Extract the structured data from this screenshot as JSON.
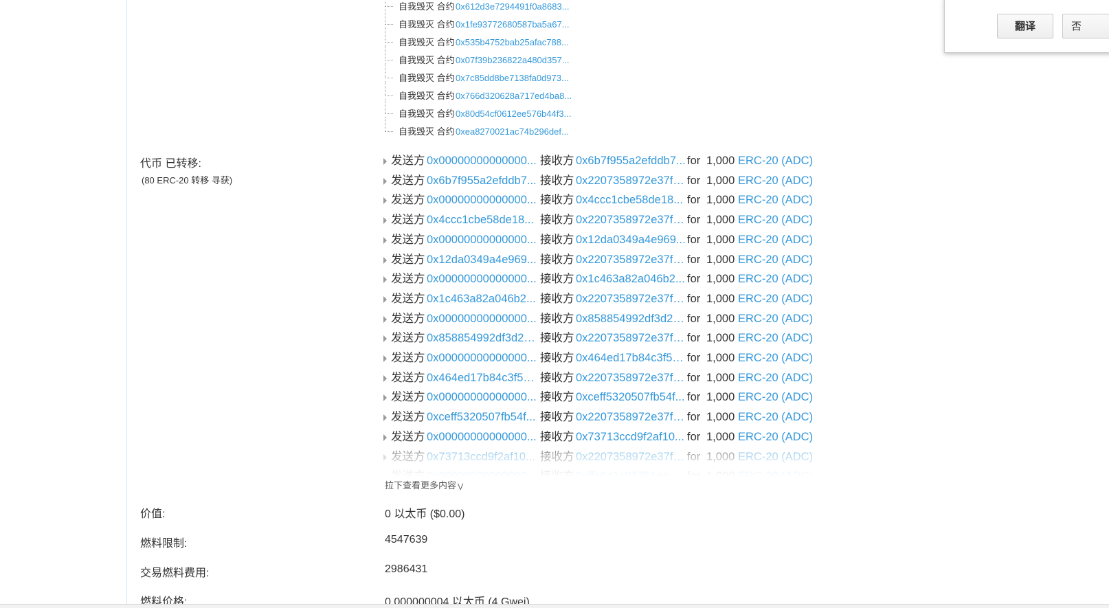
{
  "self_destruct": [
    {
      "label": "自我毁灭 合约",
      "address": "0x612d3e7294491f0a8683..."
    },
    {
      "label": "自我毁灭 合约",
      "address": "0x1fe93772680587ba5a67..."
    },
    {
      "label": "自我毁灭 合约",
      "address": "0x535b4752bab25afac788..."
    },
    {
      "label": "自我毁灭 合约",
      "address": "0x07f39b236822a480d357..."
    },
    {
      "label": "自我毁灭 合约",
      "address": "0x7c85dd8be7138fa0d973..."
    },
    {
      "label": "自我毁灭 合约",
      "address": "0x766d320628a717ed4ba8..."
    },
    {
      "label": "自我毁灭 合约",
      "address": "0x80d54cf0612ee576b44f3..."
    },
    {
      "label": "自我毁灭 合约",
      "address": "0xea8270021ac74b296def..."
    }
  ],
  "token_transfers": {
    "label": "代币 已转移:",
    "sub_label": "(80 ERC-20 转移 寻获)",
    "from_label": "发送方",
    "to_label": "接收方",
    "for_label": "for",
    "rows": [
      {
        "from": "0x00000000000000...",
        "to": "0x6b7f955a2efddb7...",
        "amount": "1,000",
        "token": "ERC-20 (ADC)"
      },
      {
        "from": "0x6b7f955a2efddb7...",
        "to": "0x2207358972e37f6...",
        "amount": "1,000",
        "token": "ERC-20 (ADC)"
      },
      {
        "from": "0x00000000000000...",
        "to": "0x4ccc1cbe58de18...",
        "amount": "1,000",
        "token": "ERC-20 (ADC)"
      },
      {
        "from": "0x4ccc1cbe58de18...",
        "to": "0x2207358972e37f6...",
        "amount": "1,000",
        "token": "ERC-20 (ADC)"
      },
      {
        "from": "0x00000000000000...",
        "to": "0x12da0349a4e969...",
        "amount": "1,000",
        "token": "ERC-20 (ADC)"
      },
      {
        "from": "0x12da0349a4e969...",
        "to": "0x2207358972e37f6...",
        "amount": "1,000",
        "token": "ERC-20 (ADC)"
      },
      {
        "from": "0x00000000000000...",
        "to": "0x1c463a82a046b2...",
        "amount": "1,000",
        "token": "ERC-20 (ADC)"
      },
      {
        "from": "0x1c463a82a046b2...",
        "to": "0x2207358972e37f6...",
        "amount": "1,000",
        "token": "ERC-20 (ADC)"
      },
      {
        "from": "0x00000000000000...",
        "to": "0x858854992df3d2d...",
        "amount": "1,000",
        "token": "ERC-20 (ADC)"
      },
      {
        "from": "0x858854992df3d2d...",
        "to": "0x2207358972e37f6...",
        "amount": "1,000",
        "token": "ERC-20 (ADC)"
      },
      {
        "from": "0x00000000000000...",
        "to": "0x464ed17b84c3f53...",
        "amount": "1,000",
        "token": "ERC-20 (ADC)"
      },
      {
        "from": "0x464ed17b84c3f53...",
        "to": "0x2207358972e37f6...",
        "amount": "1,000",
        "token": "ERC-20 (ADC)"
      },
      {
        "from": "0x00000000000000...",
        "to": "0xceff5320507fb54f...",
        "amount": "1,000",
        "token": "ERC-20 (ADC)"
      },
      {
        "from": "0xceff5320507fb54f...",
        "to": "0x2207358972e37f6...",
        "amount": "1,000",
        "token": "ERC-20 (ADC)"
      },
      {
        "from": "0x00000000000000...",
        "to": "0x73713ccd9f2af10...",
        "amount": "1,000",
        "token": "ERC-20 (ADC)"
      },
      {
        "from": "0x73713ccd9f2af10...",
        "to": "0x2207358972e37f6...",
        "amount": "1,000",
        "token": "ERC-20 (ADC)"
      },
      {
        "from": "0x00000000000000...",
        "to": "0xffe6d1c81751ea4f...",
        "amount": "1,000",
        "token": "ERC-20 (ADC)"
      }
    ],
    "more_label": "拉下查看更多内容",
    "more_icon": "chevron-double-down-icon"
  },
  "details": [
    {
      "label": "价值:",
      "value": "0 以太币 ($0.00)"
    },
    {
      "label": "燃料限制:",
      "value": "4547639"
    },
    {
      "label": "交易燃料费用:",
      "value": "2986431"
    },
    {
      "label": "燃料价格:",
      "value": "0.000000004 以太币 (4 Gwei)"
    }
  ],
  "translate_popup": {
    "translate_label": "翻译",
    "no_label": "否"
  },
  "colors": {
    "link": "#3498db",
    "text": "#333333",
    "rule": "#cfe6f2"
  }
}
